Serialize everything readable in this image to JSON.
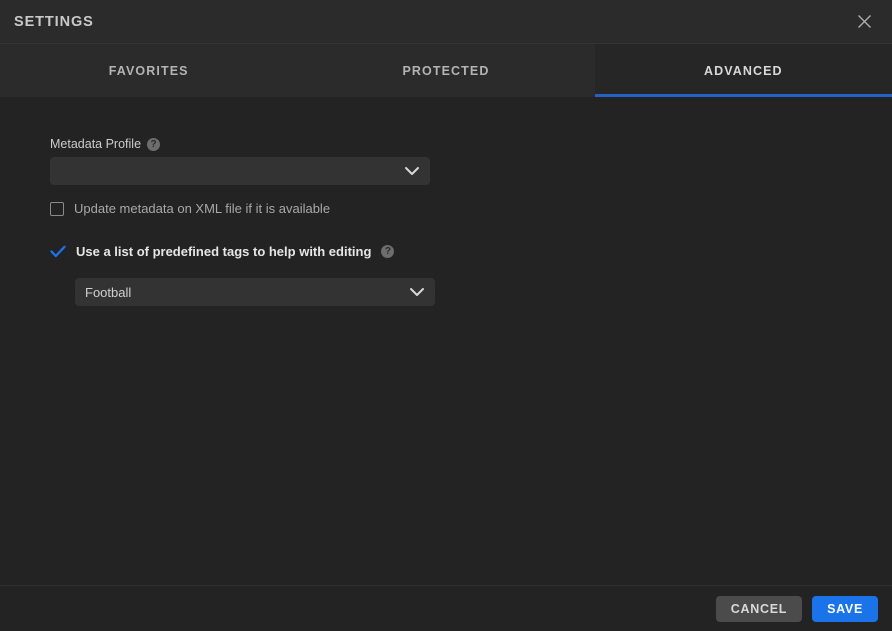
{
  "window": {
    "title": "SETTINGS",
    "close_icon": "close-icon"
  },
  "tabs": [
    {
      "label": "FAVORITES",
      "active": false
    },
    {
      "label": "PROTECTED",
      "active": false
    },
    {
      "label": "ADVANCED",
      "active": true
    }
  ],
  "advanced": {
    "metadata_profile": {
      "label": "Metadata Profile",
      "help_icon": "help-circle-icon",
      "value": "",
      "placeholder": "",
      "chevron_icon": "chevron-down-icon"
    },
    "update_metadata": {
      "label": "Update metadata on XML file if it is available",
      "checked": false
    },
    "predefined_tags": {
      "label": "Use a list of predefined tags to help with editing",
      "help_icon": "help-circle-icon",
      "checked": true,
      "tag_list": {
        "value": "Football",
        "chevron_icon": "chevron-down-icon"
      }
    }
  },
  "footer": {
    "cancel_label": "CANCEL",
    "save_label": "SAVE"
  },
  "colors": {
    "accent_blue": "#1a73e8",
    "tab_underline": "#2463c4",
    "panel_bg": "#232323",
    "header_bg": "#2b2b2b",
    "field_bg": "#333333",
    "cancel_bg": "#4b4b4b"
  }
}
